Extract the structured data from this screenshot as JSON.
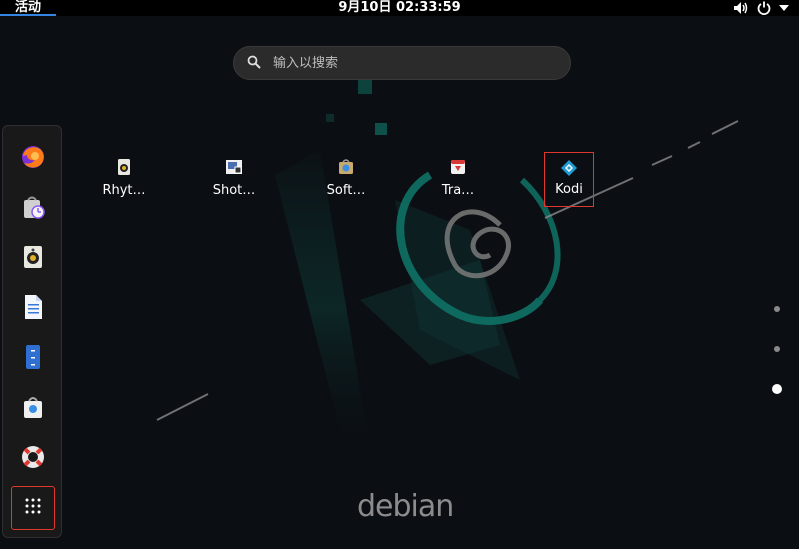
{
  "topbar": {
    "activities_label": "活动",
    "clock": "9月10日  02:33:59",
    "icons": [
      "volume-icon",
      "power-icon",
      "menu-arrow-icon"
    ]
  },
  "search": {
    "placeholder": "输入以搜索",
    "value": ""
  },
  "dash": {
    "items": [
      {
        "name": "firefox",
        "icon": "firefox-icon"
      },
      {
        "name": "software-store",
        "icon": "store-icon"
      },
      {
        "name": "rhythmbox",
        "icon": "speaker-icon"
      },
      {
        "name": "document",
        "icon": "document-icon"
      },
      {
        "name": "file-manager",
        "icon": "files-icon"
      },
      {
        "name": "software",
        "icon": "software-bag-icon"
      },
      {
        "name": "help",
        "icon": "lifebuoy-icon"
      }
    ],
    "show_apps_icon": "grid-icon"
  },
  "apps": [
    {
      "label": "Rhyt…",
      "icon": "rhythmbox-icon"
    },
    {
      "label": "Shot…",
      "icon": "screenshot-icon"
    },
    {
      "label": "Soft…",
      "icon": "software-icon"
    },
    {
      "label": "Tra…",
      "icon": "transmission-icon"
    },
    {
      "label": "Kodi",
      "icon": "kodi-icon"
    }
  ],
  "pager": {
    "pages": 3,
    "current": 3
  },
  "wallpaper": {
    "brand": "debian"
  },
  "colors": {
    "accent": "#3584e4",
    "highlight": "#e0372e",
    "teal": "#0f6e62"
  }
}
